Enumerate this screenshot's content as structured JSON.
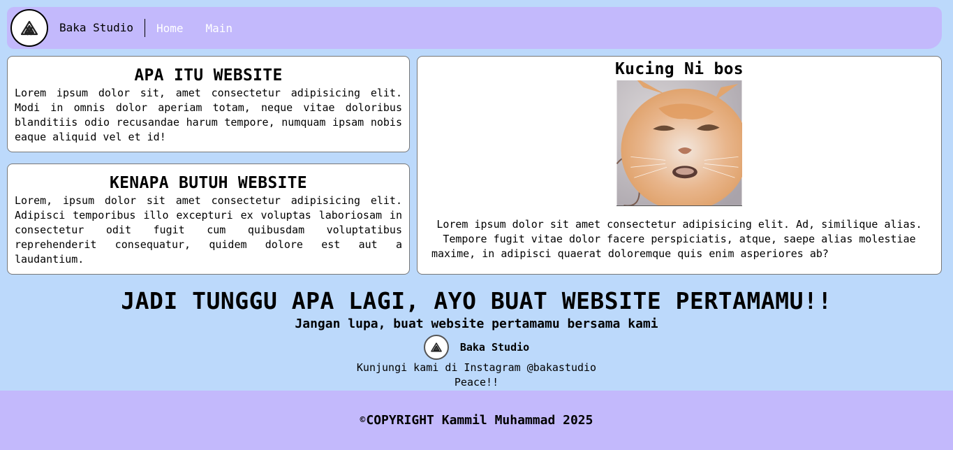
{
  "header": {
    "brand": "Baka Studio",
    "nav": [
      "Home",
      "Main"
    ]
  },
  "cards": {
    "website": {
      "title": "APA ITU WEBSITE",
      "text": "Lorem ipsum dolor sit, amet consectetur adipisicing elit. Modi in omnis dolor aperiam totam, neque vitae doloribus blanditiis odio recusandae harum tempore, numquam ipsam nobis eaque aliquid vel et id!"
    },
    "why": {
      "title": "KENAPA BUTUH WEBSITE",
      "text": "Lorem, ipsum dolor sit amet consectetur adipisicing elit. Adipisci temporibus illo excepturi ex voluptas laboriosam in consectetur odit fugit cum quibusdam voluptatibus reprehenderit consequatur, quidem dolore est aut a laudantium."
    },
    "cat": {
      "title": "Kucing Ni bos",
      "text": "Lorem ipsum dolor sit amet consectetur adipisicing elit. Ad, similique alias. Tempore fugit vitae dolor facere perspiciatis, atque, saepe alias molestiae maxime, in adipisci quaerat doloremque quis enim asperiores ab?"
    }
  },
  "cta": {
    "headline": "JADI TUNGGU APA LAGI, AYO BUAT WEBSITE PERTAMAMU!!",
    "subheadline": "Jangan lupa, buat website pertamamu bersama kami",
    "brand": "Baka Studio",
    "instagram": "Kunjungi kami di Instagram @bakastudio",
    "closing": "Peace!!"
  },
  "footer": {
    "symbol": "©",
    "text": "COPYRIGHT Kammil Muhammad 2025"
  },
  "colors": {
    "background": "#bcd9fb",
    "bar": "#c3b9fc",
    "card": "#ffffff"
  },
  "icons": [
    "studio-logo-icon",
    "cat-photo"
  ]
}
